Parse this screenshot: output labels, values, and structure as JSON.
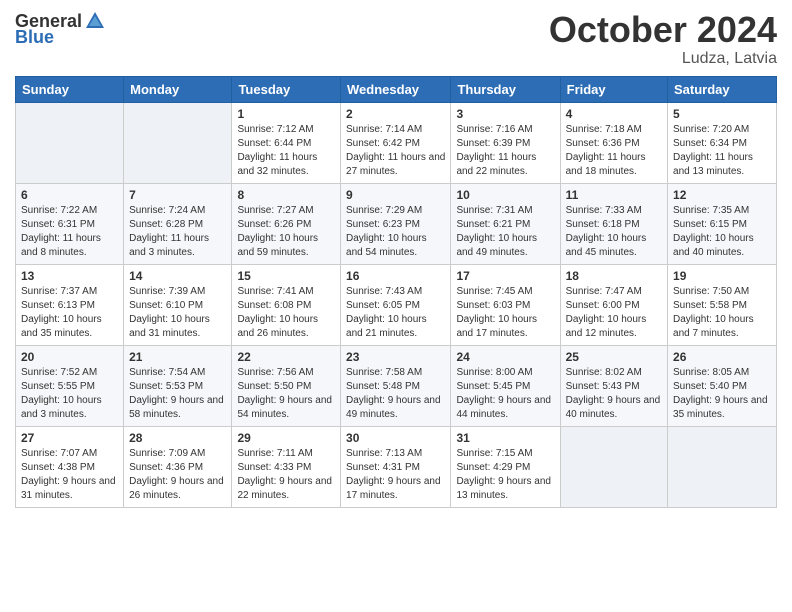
{
  "header": {
    "logo_general": "General",
    "logo_blue": "Blue",
    "month_title": "October 2024",
    "location": "Ludza, Latvia"
  },
  "days_of_week": [
    "Sunday",
    "Monday",
    "Tuesday",
    "Wednesday",
    "Thursday",
    "Friday",
    "Saturday"
  ],
  "weeks": [
    [
      {
        "day": "",
        "sunrise": "",
        "sunset": "",
        "daylight": ""
      },
      {
        "day": "",
        "sunrise": "",
        "sunset": "",
        "daylight": ""
      },
      {
        "day": "1",
        "sunrise": "Sunrise: 7:12 AM",
        "sunset": "Sunset: 6:44 PM",
        "daylight": "Daylight: 11 hours and 32 minutes."
      },
      {
        "day": "2",
        "sunrise": "Sunrise: 7:14 AM",
        "sunset": "Sunset: 6:42 PM",
        "daylight": "Daylight: 11 hours and 27 minutes."
      },
      {
        "day": "3",
        "sunrise": "Sunrise: 7:16 AM",
        "sunset": "Sunset: 6:39 PM",
        "daylight": "Daylight: 11 hours and 22 minutes."
      },
      {
        "day": "4",
        "sunrise": "Sunrise: 7:18 AM",
        "sunset": "Sunset: 6:36 PM",
        "daylight": "Daylight: 11 hours and 18 minutes."
      },
      {
        "day": "5",
        "sunrise": "Sunrise: 7:20 AM",
        "sunset": "Sunset: 6:34 PM",
        "daylight": "Daylight: 11 hours and 13 minutes."
      }
    ],
    [
      {
        "day": "6",
        "sunrise": "Sunrise: 7:22 AM",
        "sunset": "Sunset: 6:31 PM",
        "daylight": "Daylight: 11 hours and 8 minutes."
      },
      {
        "day": "7",
        "sunrise": "Sunrise: 7:24 AM",
        "sunset": "Sunset: 6:28 PM",
        "daylight": "Daylight: 11 hours and 3 minutes."
      },
      {
        "day": "8",
        "sunrise": "Sunrise: 7:27 AM",
        "sunset": "Sunset: 6:26 PM",
        "daylight": "Daylight: 10 hours and 59 minutes."
      },
      {
        "day": "9",
        "sunrise": "Sunrise: 7:29 AM",
        "sunset": "Sunset: 6:23 PM",
        "daylight": "Daylight: 10 hours and 54 minutes."
      },
      {
        "day": "10",
        "sunrise": "Sunrise: 7:31 AM",
        "sunset": "Sunset: 6:21 PM",
        "daylight": "Daylight: 10 hours and 49 minutes."
      },
      {
        "day": "11",
        "sunrise": "Sunrise: 7:33 AM",
        "sunset": "Sunset: 6:18 PM",
        "daylight": "Daylight: 10 hours and 45 minutes."
      },
      {
        "day": "12",
        "sunrise": "Sunrise: 7:35 AM",
        "sunset": "Sunset: 6:15 PM",
        "daylight": "Daylight: 10 hours and 40 minutes."
      }
    ],
    [
      {
        "day": "13",
        "sunrise": "Sunrise: 7:37 AM",
        "sunset": "Sunset: 6:13 PM",
        "daylight": "Daylight: 10 hours and 35 minutes."
      },
      {
        "day": "14",
        "sunrise": "Sunrise: 7:39 AM",
        "sunset": "Sunset: 6:10 PM",
        "daylight": "Daylight: 10 hours and 31 minutes."
      },
      {
        "day": "15",
        "sunrise": "Sunrise: 7:41 AM",
        "sunset": "Sunset: 6:08 PM",
        "daylight": "Daylight: 10 hours and 26 minutes."
      },
      {
        "day": "16",
        "sunrise": "Sunrise: 7:43 AM",
        "sunset": "Sunset: 6:05 PM",
        "daylight": "Daylight: 10 hours and 21 minutes."
      },
      {
        "day": "17",
        "sunrise": "Sunrise: 7:45 AM",
        "sunset": "Sunset: 6:03 PM",
        "daylight": "Daylight: 10 hours and 17 minutes."
      },
      {
        "day": "18",
        "sunrise": "Sunrise: 7:47 AM",
        "sunset": "Sunset: 6:00 PM",
        "daylight": "Daylight: 10 hours and 12 minutes."
      },
      {
        "day": "19",
        "sunrise": "Sunrise: 7:50 AM",
        "sunset": "Sunset: 5:58 PM",
        "daylight": "Daylight: 10 hours and 7 minutes."
      }
    ],
    [
      {
        "day": "20",
        "sunrise": "Sunrise: 7:52 AM",
        "sunset": "Sunset: 5:55 PM",
        "daylight": "Daylight: 10 hours and 3 minutes."
      },
      {
        "day": "21",
        "sunrise": "Sunrise: 7:54 AM",
        "sunset": "Sunset: 5:53 PM",
        "daylight": "Daylight: 9 hours and 58 minutes."
      },
      {
        "day": "22",
        "sunrise": "Sunrise: 7:56 AM",
        "sunset": "Sunset: 5:50 PM",
        "daylight": "Daylight: 9 hours and 54 minutes."
      },
      {
        "day": "23",
        "sunrise": "Sunrise: 7:58 AM",
        "sunset": "Sunset: 5:48 PM",
        "daylight": "Daylight: 9 hours and 49 minutes."
      },
      {
        "day": "24",
        "sunrise": "Sunrise: 8:00 AM",
        "sunset": "Sunset: 5:45 PM",
        "daylight": "Daylight: 9 hours and 44 minutes."
      },
      {
        "day": "25",
        "sunrise": "Sunrise: 8:02 AM",
        "sunset": "Sunset: 5:43 PM",
        "daylight": "Daylight: 9 hours and 40 minutes."
      },
      {
        "day": "26",
        "sunrise": "Sunrise: 8:05 AM",
        "sunset": "Sunset: 5:40 PM",
        "daylight": "Daylight: 9 hours and 35 minutes."
      }
    ],
    [
      {
        "day": "27",
        "sunrise": "Sunrise: 7:07 AM",
        "sunset": "Sunset: 4:38 PM",
        "daylight": "Daylight: 9 hours and 31 minutes."
      },
      {
        "day": "28",
        "sunrise": "Sunrise: 7:09 AM",
        "sunset": "Sunset: 4:36 PM",
        "daylight": "Daylight: 9 hours and 26 minutes."
      },
      {
        "day": "29",
        "sunrise": "Sunrise: 7:11 AM",
        "sunset": "Sunset: 4:33 PM",
        "daylight": "Daylight: 9 hours and 22 minutes."
      },
      {
        "day": "30",
        "sunrise": "Sunrise: 7:13 AM",
        "sunset": "Sunset: 4:31 PM",
        "daylight": "Daylight: 9 hours and 17 minutes."
      },
      {
        "day": "31",
        "sunrise": "Sunrise: 7:15 AM",
        "sunset": "Sunset: 4:29 PM",
        "daylight": "Daylight: 9 hours and 13 minutes."
      },
      {
        "day": "",
        "sunrise": "",
        "sunset": "",
        "daylight": ""
      },
      {
        "day": "",
        "sunrise": "",
        "sunset": "",
        "daylight": ""
      }
    ]
  ]
}
